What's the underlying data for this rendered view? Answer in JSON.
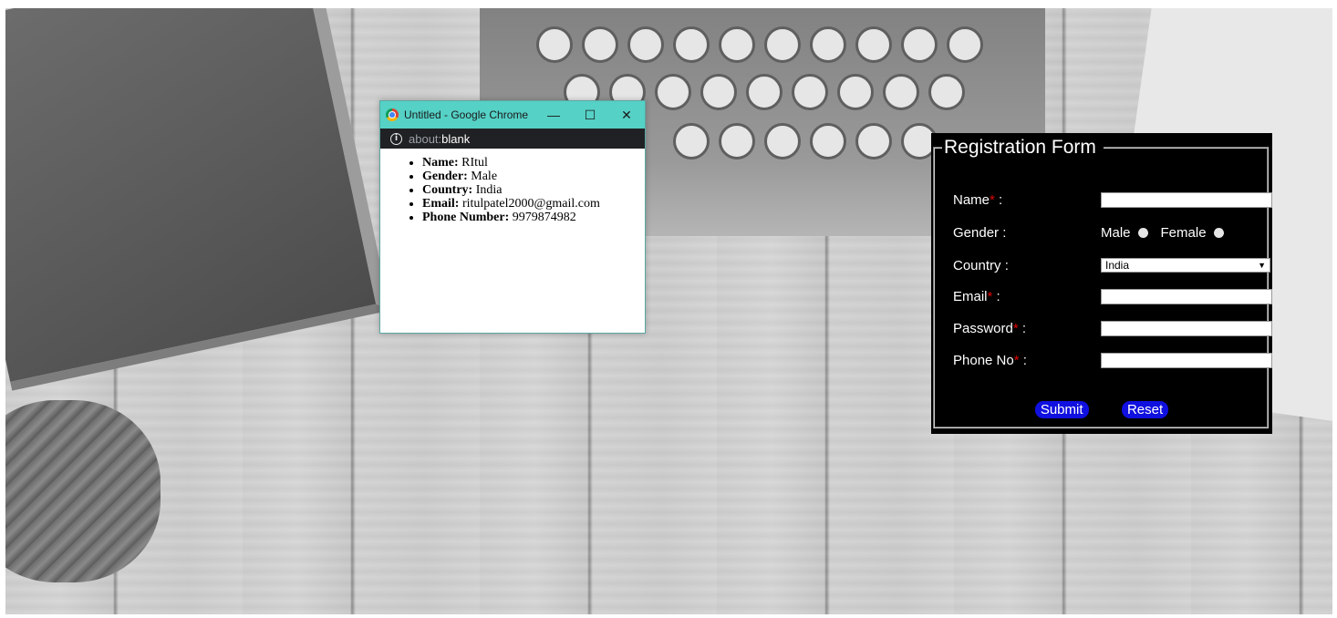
{
  "popup": {
    "window_title": "Untitled - Google Chrome",
    "minimize_glyph": "—",
    "maximize_glyph": "☐",
    "close_glyph": "✕",
    "url_scheme": "about:",
    "url_path": "blank",
    "details": [
      {
        "label": "Name:",
        "value": "RItul"
      },
      {
        "label": "Gender:",
        "value": "Male"
      },
      {
        "label": "Country:",
        "value": "India"
      },
      {
        "label": "Email:",
        "value": "ritulpatel2000@gmail.com"
      },
      {
        "label": "Phone Number:",
        "value": "9979874982"
      }
    ]
  },
  "form": {
    "legend": "Registration Form",
    "required_mark": "*",
    "colon": ":",
    "name_label": "Name",
    "gender_label": "Gender :",
    "gender_options": [
      "Male",
      "Female"
    ],
    "country_label": "Country :",
    "country_value": "India",
    "email_label": "Email",
    "password_label": "Password",
    "phone_label": "Phone No",
    "submit_label": "Submit",
    "reset_label": "Reset"
  },
  "colors": {
    "titlebar": "#55d1c6",
    "button": "#1010e0",
    "required": "#e00000"
  }
}
